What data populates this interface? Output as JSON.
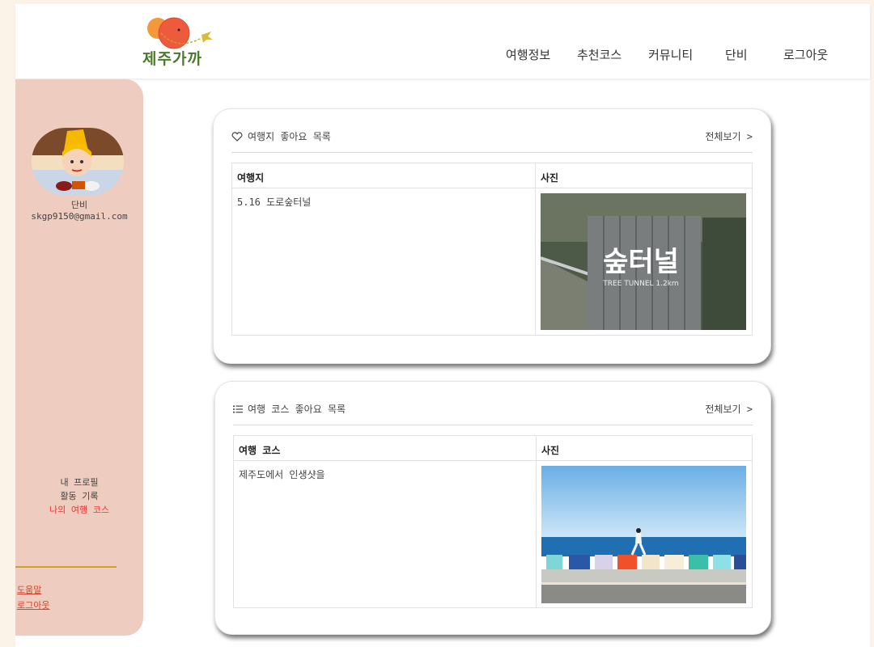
{
  "header": {
    "logo_text": "제주가까",
    "nav": [
      "여행정보",
      "추천코스",
      "커뮤니티",
      "단비",
      "로그아웃"
    ]
  },
  "sidebar": {
    "username": "단비",
    "email": "skgp9150@gmail.com",
    "menu": [
      "내 프로필",
      "활동 기록",
      "나의 여행 코스"
    ],
    "links": [
      "도움말",
      "로그아웃"
    ]
  },
  "likes_places": {
    "title": "여행지 좋아요 목록",
    "more": "전체보기 >",
    "columns": [
      "여행지",
      "사진"
    ],
    "rows": [
      {
        "name": "5.16 도로숲터널",
        "photo_title": "숲터널",
        "photo_subtitle": "TREE TUNNEL 1.2km"
      }
    ]
  },
  "likes_courses": {
    "title": "여행 코스 좋아요 목록",
    "more": "전체보기 >",
    "columns": [
      "여행 코스",
      "사진"
    ],
    "rows": [
      {
        "name": "제주도에서 인생샷을"
      }
    ]
  },
  "colors": {
    "background": "#fbf3e8",
    "sidebar": "#eeccbf",
    "accent_red": "#e53935",
    "link": "#d2452d",
    "divider": "#c9a227"
  }
}
